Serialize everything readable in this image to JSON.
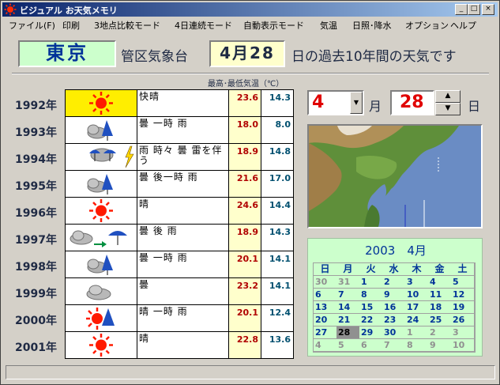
{
  "window": {
    "title": "ビジュアル お天気メモリ",
    "min_glyph": "_",
    "max_glyph": "□",
    "close_glyph": "×"
  },
  "menu": [
    "ファイル(F)",
    "印刷",
    "3地点比較モード",
    "4日連続モード",
    "自動表示モード",
    "気温",
    "日照･降水",
    "オプション",
    "ヘルプ"
  ],
  "header": {
    "city": "東京",
    "office": "管区気象台",
    "date": "4月28",
    "suffix": "日の過去10年間の天気です"
  },
  "table": {
    "caption": "最高･最低気温（℃）",
    "rows": [
      {
        "year": "1992年",
        "desc": "快晴",
        "max": "23.6",
        "min": "14.3",
        "icon": "sun-icon"
      },
      {
        "year": "1993年",
        "desc": "曇 一時 雨",
        "max": "18.0",
        "min": "8.0",
        "icon": "cloud-rain-icon"
      },
      {
        "year": "1994年",
        "desc": "雨 時々 曇 雷を伴う",
        "max": "18.9",
        "min": "14.8",
        "icon": "rain-thunder-icon"
      },
      {
        "year": "1995年",
        "desc": "曇 後一時 雨",
        "max": "21.6",
        "min": "17.0",
        "icon": "cloud-rain-icon"
      },
      {
        "year": "1996年",
        "desc": "晴",
        "max": "24.6",
        "min": "14.4",
        "icon": "sun-icon"
      },
      {
        "year": "1997年",
        "desc": "曇 後 雨",
        "max": "18.9",
        "min": "14.3",
        "icon": "cloud-to-rain-icon"
      },
      {
        "year": "1998年",
        "desc": "曇 一時 雨",
        "max": "20.1",
        "min": "14.1",
        "icon": "cloud-rain-icon"
      },
      {
        "year": "1999年",
        "desc": "曇",
        "max": "23.2",
        "min": "14.1",
        "icon": "cloud-icon"
      },
      {
        "year": "2000年",
        "desc": "晴 一時 雨",
        "max": "20.1",
        "min": "12.4",
        "icon": "sun-rain-icon"
      },
      {
        "year": "2001年",
        "desc": "晴",
        "max": "22.8",
        "min": "13.6",
        "icon": "sun-icon"
      }
    ]
  },
  "selector": {
    "month": "4",
    "month_label": "月",
    "day": "28",
    "day_label": "日",
    "dropdown_glyph": "▼",
    "up_glyph": "▲",
    "down_glyph": "▼"
  },
  "calendar": {
    "title": "2003　4月",
    "weekdays": [
      "日",
      "月",
      "火",
      "水",
      "木",
      "金",
      "土"
    ],
    "weeks": [
      [
        "30",
        "31",
        "1",
        "2",
        "3",
        "4",
        "5"
      ],
      [
        "6",
        "7",
        "8",
        "9",
        "10",
        "11",
        "12"
      ],
      [
        "13",
        "14",
        "15",
        "16",
        "17",
        "18",
        "19"
      ],
      [
        "20",
        "21",
        "22",
        "23",
        "24",
        "25",
        "26"
      ],
      [
        "27",
        "28",
        "29",
        "30",
        "1",
        "2",
        "3"
      ],
      [
        "4",
        "5",
        "6",
        "7",
        "8",
        "9",
        "10"
      ]
    ],
    "selected": "28",
    "colors": {
      "accent": "#003399",
      "background": "#ccffcc"
    }
  }
}
